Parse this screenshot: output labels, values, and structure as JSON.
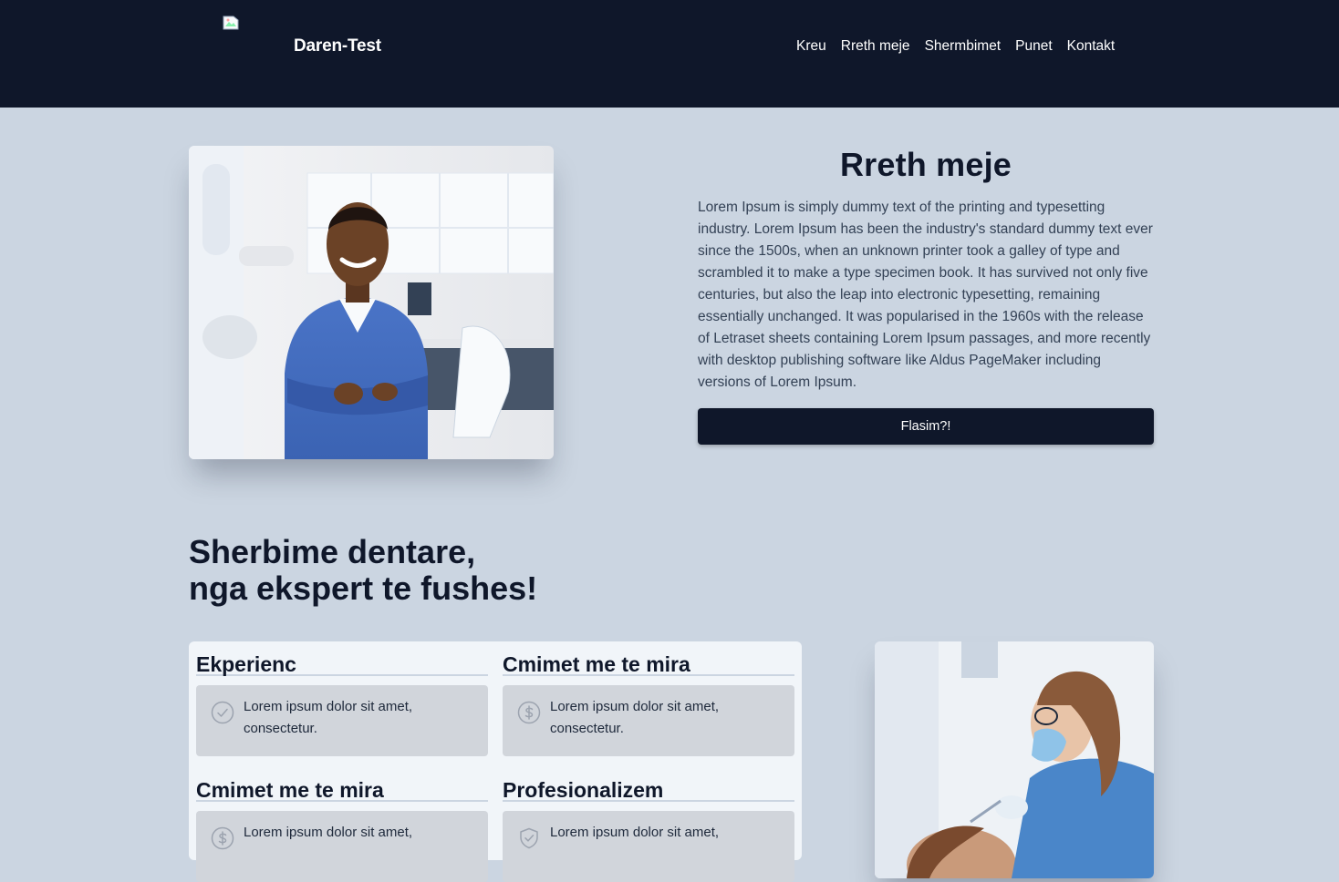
{
  "header": {
    "brand": "Daren-Test",
    "nav": [
      "Kreu",
      "Rreth meje",
      "Shermbimet",
      "Punet",
      "Kontakt"
    ]
  },
  "about": {
    "title": "Rreth meje",
    "text": "Lorem Ipsum is simply dummy text of the printing and typesetting industry. Lorem Ipsum has been the industry's standard dummy text ever since the 1500s, when an unknown printer took a galley of type and scrambled it to make a type specimen book. It has survived not only five centuries, but also the leap into electronic typesetting, remaining essentially unchanged. It was popularised in the 1960s with the release of Letraset sheets containing Lorem Ipsum passages, and more recently with desktop publishing software like Aldus PageMaker including versions of Lorem Ipsum.",
    "button": "Flasim?!"
  },
  "services": {
    "title_line1": "Sherbime dentare,",
    "title_line2": "nga ekspert te fushes!",
    "features": [
      {
        "title": "Ekperienc",
        "text": "Lorem ipsum dolor sit amet, consectetur.",
        "icon": "check-circle-icon"
      },
      {
        "title": "Cmimet me te mira",
        "text": "Lorem ipsum dolor sit amet, consectetur.",
        "icon": "dollar-circle-icon"
      },
      {
        "title": "Cmimet me te mira",
        "text": "Lorem ipsum dolor sit amet,",
        "icon": "dollar-circle-icon"
      },
      {
        "title": "Profesionalizem",
        "text": "Lorem ipsum dolor sit amet,",
        "icon": "shield-check-icon"
      }
    ]
  },
  "colors": {
    "header_bg": "#0f172a",
    "page_bg": "#cbd5e1",
    "panel_bg": "#f1f5f9",
    "feature_box_bg": "#d1d5db",
    "button_bg": "#0f172a"
  }
}
